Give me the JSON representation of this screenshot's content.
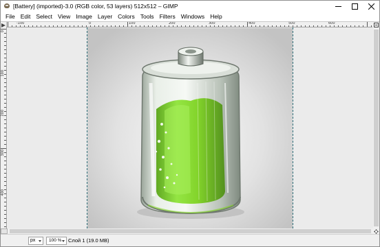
{
  "window": {
    "title": "[Battery] (imported)-3.0 (RGB color, 53 layers) 512x512 – GIMP"
  },
  "menu": [
    "File",
    "Edit",
    "Select",
    "View",
    "Image",
    "Layer",
    "Colors",
    "Tools",
    "Filters",
    "Windows",
    "Help"
  ],
  "ruler": {
    "horizontal_labels": [
      "-100",
      "0",
      "100",
      "200",
      "300",
      "400",
      "500",
      "600"
    ],
    "vertical_labels": [
      "0",
      "100",
      "200",
      "300",
      "400"
    ]
  },
  "statusbar": {
    "unit": "px",
    "zoom": "100 %",
    "layer_info": "Слой 1 (19.0 MB)"
  },
  "colors": {
    "canvas_bg": "#ebebeb",
    "battery_green": "#7ed321",
    "guide": "#2f6f7a"
  },
  "icons": {
    "app": "gimp-wilber-icon",
    "minimize": "minimize-icon",
    "maximize": "maximize-icon",
    "close": "close-icon",
    "menu_arrow": "image-menu-arrow-icon",
    "zoom_toggle": "zoom-toggle-icon",
    "navigate": "navigate-icon"
  }
}
